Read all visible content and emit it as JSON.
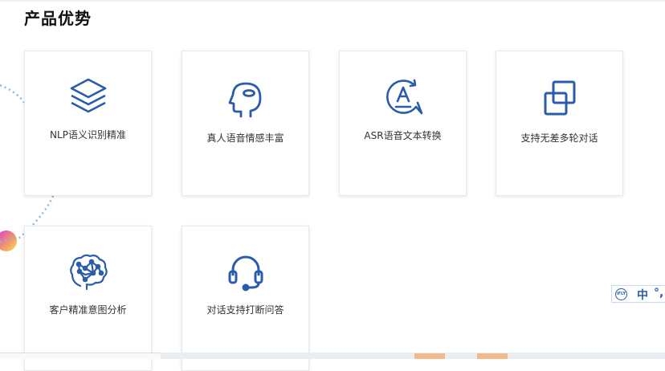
{
  "section": {
    "title": "产品优势"
  },
  "cards": [
    {
      "label": "NLP语义识别精准",
      "icon": "layers-icon"
    },
    {
      "label": "真人语音情感丰富",
      "icon": "human-head-icon"
    },
    {
      "label": "ASR语音文本转换",
      "icon": "speech-text-icon"
    },
    {
      "label": "支持无差多轮对话",
      "icon": "overlap-squares-icon"
    },
    {
      "label": "客户精准意图分析",
      "icon": "brain-network-icon"
    },
    {
      "label": "对话支持打断问答",
      "icon": "headset-icon"
    }
  ],
  "ime_toolbar": {
    "logo": "iFLY",
    "mode": "中",
    "punct": "°,"
  },
  "colors": {
    "icon": "#2a5caa",
    "accent_orange": "#f2b98a"
  }
}
